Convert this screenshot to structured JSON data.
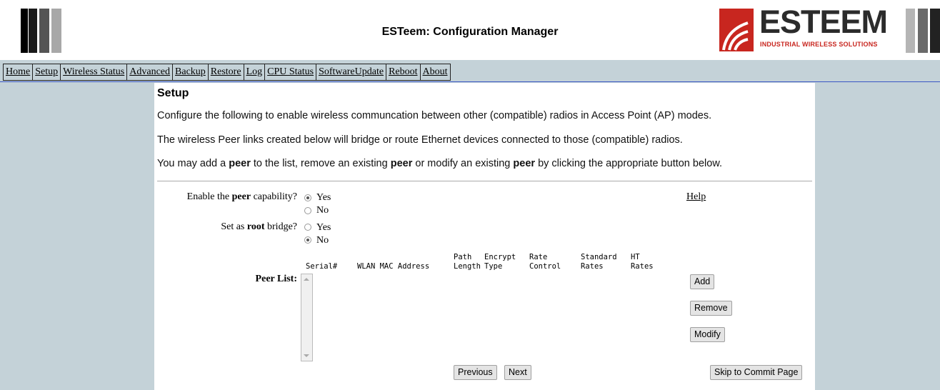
{
  "header": {
    "title": "ESTeem: Configuration Manager",
    "logo_text": "ESTEEM",
    "logo_tagline": "INDUSTRIAL WIRELESS SOLUTIONS",
    "logo_colors": [
      "#c8261f",
      "#2b2b2b"
    ]
  },
  "nav": {
    "items": [
      "Home",
      "Setup",
      "Wireless Status",
      "Advanced",
      "Backup",
      "Restore",
      "Log",
      "CPU Status",
      "SoftwareUpdate",
      "Reboot",
      "About"
    ]
  },
  "page": {
    "heading": "Setup",
    "paragraphs": {
      "p1": "Configure the following to enable wireless communcation between other (compatible) radios in Access Point (AP) modes.",
      "p2": "The wireless Peer links created below will bridge or route Ethernet devices connected to those (compatible) radios.",
      "p3_prefix": "You may add a ",
      "p3_b1": "peer",
      "p3_mid1": " to the list, remove an existing ",
      "p3_b2": "peer",
      "p3_mid2": " or modify an existing ",
      "p3_b3": "peer",
      "p3_suffix": " by clicking the appropriate button below."
    }
  },
  "form": {
    "enable_peer": {
      "label_prefix": "Enable the ",
      "label_bold": "peer",
      "label_suffix": " capability?",
      "yes": "Yes",
      "no": "No",
      "selected": "Yes"
    },
    "root_bridge": {
      "label_prefix": "Set as ",
      "label_bold": "root",
      "label_suffix": " bridge?",
      "yes": "Yes",
      "no": "No",
      "selected": "No"
    },
    "help_link": "Help",
    "peer_list": {
      "label": "Peer List:",
      "columns": {
        "serial": "Serial#",
        "wlan_mac": "WLAN MAC Address",
        "path_length": "Path\nLength",
        "encrypt_type": "Encrypt\nType",
        "rate_control": "Rate\nControl",
        "standard_rates": "Standard\nRates",
        "ht_rates": "HT\nRates"
      }
    },
    "buttons": {
      "add": "Add",
      "remove": "Remove",
      "modify": "Modify",
      "previous": "Previous",
      "next": "Next",
      "skip": "Skip to Commit Page"
    }
  }
}
